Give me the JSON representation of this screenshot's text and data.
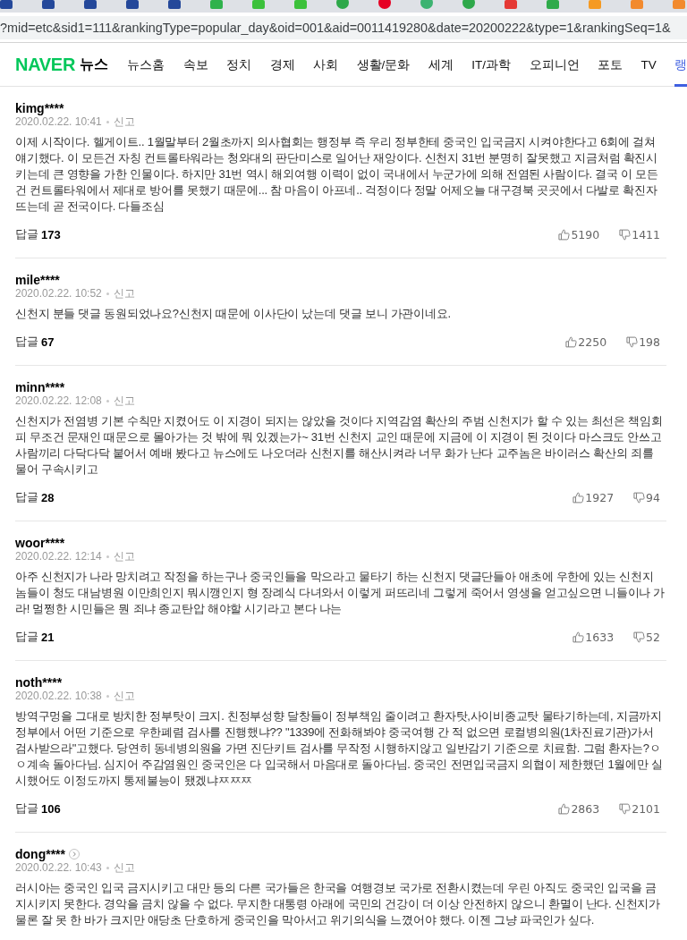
{
  "toolbar": {
    "url": "?mid=etc&sid1=111&rankingType=popular_day&oid=001&aid=0011419280&date=20200222&type=1&rankingSeq=1&"
  },
  "nav": {
    "logo": "NAVER",
    "section": "뉴스",
    "items": [
      {
        "label": "뉴스홈",
        "selected": false
      },
      {
        "label": "속보",
        "selected": false
      },
      {
        "label": "정치",
        "selected": false
      },
      {
        "label": "경제",
        "selected": false
      },
      {
        "label": "사회",
        "selected": false
      },
      {
        "label": "생활/문화",
        "selected": false
      },
      {
        "label": "세계",
        "selected": false
      },
      {
        "label": "IT/과학",
        "selected": false
      },
      {
        "label": "오피니언",
        "selected": false
      },
      {
        "label": "포토",
        "selected": false
      },
      {
        "label": "TV",
        "selected": false
      },
      {
        "label": "랭",
        "selected": true
      }
    ]
  },
  "comments": [
    {
      "user": "kimg****",
      "profile_link": false,
      "date": "2020.02.22. 10:41",
      "report": "신고",
      "text": "이제 시작이다. 헬게이트.. 1월말부터 2월초까지 의사협회는 행정부 즉 우리 정부한테 중국인 입국금지 시켜야한다고 6회에 걸쳐 얘기했다. 이 모든건 자칭 컨트롤타워라는 청와대의 판단미스로 일어난 재앙이다. 신천지 31번 분명히 잘못했고 지금처럼 확진시키는데 큰 영향을 가한 인물이다. 하지만 31번 역시 해외여행 이력이 없이 국내에서 누군가에 의해 전염된 사람이다. 결국 이 모든건 컨트롤타워에서 제대로 방어를 못했기 때문에... 참 마음이 아프네.. 걱정이다 정말 어제오늘 대구경북 곳곳에서 다발로 확진자 뜨는데 곧 전국이다. 다들조심",
      "replies_label": "답글",
      "replies": "173",
      "likes": "5190",
      "dislikes": "1411"
    },
    {
      "user": "mile****",
      "profile_link": false,
      "date": "2020.02.22. 10:52",
      "report": "신고",
      "text": "신천지 분들 댓글 동원되었나요?신천지 때문에 이사단이 났는데 댓글 보니 가관이네요.",
      "replies_label": "답글",
      "replies": "67",
      "likes": "2250",
      "dislikes": "198"
    },
    {
      "user": "minn****",
      "profile_link": false,
      "date": "2020.02.22. 12:08",
      "report": "신고",
      "text": "신천지가 전염병 기본 수칙만 지켰어도 이 지경이 되지는 않았을 것이다 지역감염 확산의 주범 신천지가 할 수 있는 최선은 책임회피 무조건 문재인 때문으로 몰아가는 것 밖에 뭐 있겠는가~ 31번 신천지 교인 때문에 지금에 이 지경이 된 것이다 마스크도 안쓰고 사람끼리 다닥다닥 붙어서 예배 봤다고 뉴스에도 나오더라 신천지를 해산시켜라 너무 화가 난다 교주놈은 바이러스 확산의 죄를 물어 구속시키고",
      "replies_label": "답글",
      "replies": "28",
      "likes": "1927",
      "dislikes": "94"
    },
    {
      "user": "woor****",
      "profile_link": false,
      "date": "2020.02.22. 12:14",
      "report": "신고",
      "text": "아주 신천지가 나라 망치려고 작정을 하는구나 중국인들을 막으라고 물타기 하는 신천지 댓글단들아 애초에 우한에 있는 신천지 놈들이 청도 대남병원 이만희인지 뭐시깽인지 형 장례식 다녀와서 이렇게 퍼뜨리네 그렇게 죽어서 영생을 얻고싶으면 니들이나 가라! 멀쩡한 시민들은 뭔 죄냐 종교탄압 해야할 시기라고 본다 나는",
      "replies_label": "답글",
      "replies": "21",
      "likes": "1633",
      "dislikes": "52"
    },
    {
      "user": "noth****",
      "profile_link": false,
      "date": "2020.02.22. 10:38",
      "report": "신고",
      "text": "방역구멍을 그대로 방치한 정부탓이 크지. 친정부성향 달창들이 정부책임 줄이려고 환자탓,사이비종교탓 물타기하는데, 지금까지 정부에서 어떤 기준으로 우한폐렴 검사를 진행했냐?? \"1339에 전화해봐야 중국여행 간 적 없으면 로컬병의원(1차진료기관)가서 검사받으라\"고했다. 당연히 동네병의원을 가면 진단키트 검사를 무작정 시행하지않고 일반감기 기준으로 치료함. 그럼 환자는?ㅇㅇ계속 돌아다님. 심지어 주감염원인 중국인은 다 입국해서 마음대로 돌아다님. 중국인 전면입국금지 의협이 제한했던 1월에만 실시했어도 이정도까지 통제불능이 됐겠냐ㅉㅉㅉ",
      "replies_label": "답글",
      "replies": "106",
      "likes": "2863",
      "dislikes": "2101"
    },
    {
      "user": "dong****",
      "profile_link": true,
      "date": "2020.02.22. 10:43",
      "report": "신고",
      "text": "러시아는 중국인 입국 금지시키고 대만 등의 다른 국가들은 한국을 여행경보 국가로 전환시켰는데 우린 아직도 중국인 입국을 금지시키지 못한다. 경악을 금치 않을 수 없다. 무지한 대통령 아래에 국민의 건강이 더 이상 안전하지 않으니 환멸이 난다. 신천지가 물론 잘 못 한 바가 크지만 애당초 단호하게 중국인을 막아서고 위기의식을 느꼈어야 했다. 이젠 그냥 파국인가 싶다."
    }
  ]
}
